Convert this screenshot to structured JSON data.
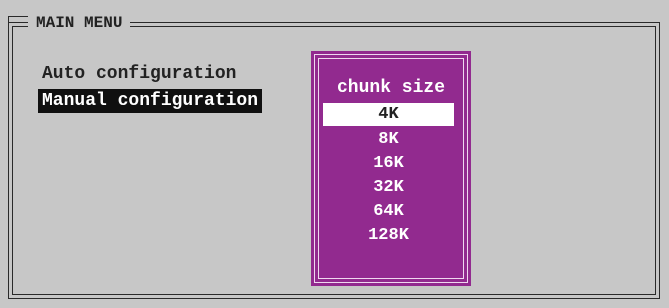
{
  "main_menu": {
    "title": "MAIN MENU",
    "items": [
      {
        "label": "Auto configuration",
        "selected": false
      },
      {
        "label": "Manual configuration",
        "selected": true
      }
    ]
  },
  "popup": {
    "title": "chunk size",
    "options": [
      {
        "label": "4K",
        "selected": true
      },
      {
        "label": "8K",
        "selected": false
      },
      {
        "label": "16K",
        "selected": false
      },
      {
        "label": "32K",
        "selected": false
      },
      {
        "label": "64K",
        "selected": false
      },
      {
        "label": "128K",
        "selected": false
      }
    ]
  },
  "colors": {
    "screen_background": "#c7c7c7",
    "popup_background": "#922a8f",
    "selection_dark": "#101010",
    "selection_light": "#ffffff"
  }
}
